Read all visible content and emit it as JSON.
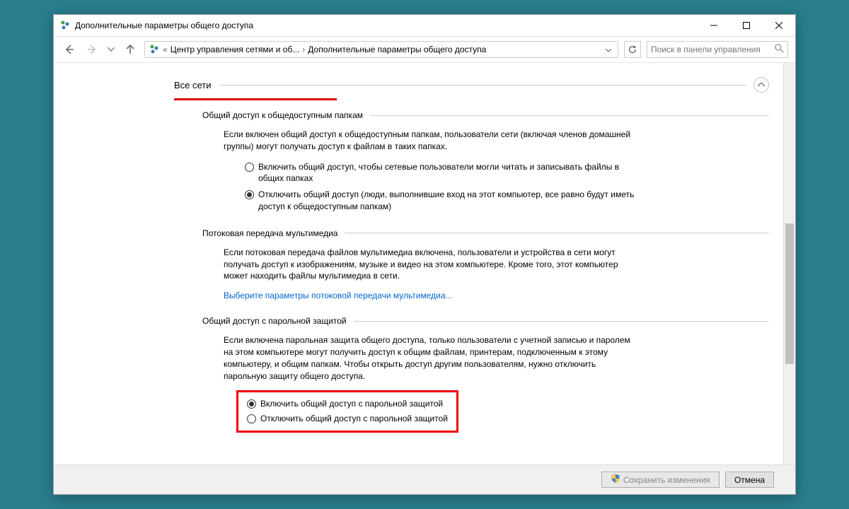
{
  "window": {
    "title": "Дополнительные параметры общего доступа"
  },
  "breadcrumb": {
    "item1": "Центр управления сетями и об...",
    "item2": "Дополнительные параметры общего доступа"
  },
  "search": {
    "placeholder": "Поиск в панели управления"
  },
  "group": {
    "title": "Все сети"
  },
  "section1": {
    "title": "Общий доступ к общедоступным папкам",
    "desc": "Если включен общий доступ к общедоступным папкам, пользователи сети (включая членов домашней группы) могут получать доступ к файлам в таких папках.",
    "radio1": "Включить общий доступ, чтобы сетевые пользователи могли читать и записывать файлы в общих папках",
    "radio2": "Отключить общий доступ (люди, выполнившие вход на этот компьютер, все равно будут иметь доступ к общедоступным папкам)"
  },
  "section2": {
    "title": "Потоковая передача мультимедиа",
    "desc": "Если потоковая передача файлов мультимедиа включена, пользователи и устройства в сети могут получать доступ к изображениям, музыке и видео на этом компьютере. Кроме того, этот компьютер может находить файлы мультимедиа в сети.",
    "link": "Выберите параметры потоковой передачи мультимедиа..."
  },
  "section3": {
    "title": "Общий доступ с парольной защитой",
    "desc": "Если включена парольная защита общего доступа, только пользователи с учетной записью и паролем на этом компьютере могут получить доступ к общим файлам, принтерам, подключенным к этому компьютеру, и общим папкам. Чтобы открыть доступ другим пользователям, нужно отключить парольную защиту общего доступа.",
    "radio1": "Включить общий доступ с парольной защитой",
    "radio2": "Отключить общий доступ с парольной защитой"
  },
  "footer": {
    "save": "Сохранить изменения",
    "cancel": "Отмена"
  }
}
